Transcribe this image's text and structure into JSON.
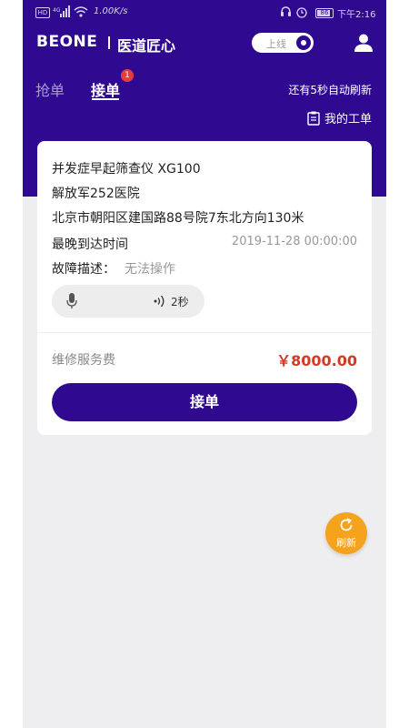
{
  "status_bar": {
    "hd": "HD",
    "network": "4G",
    "speed": "1.00K/s",
    "battery": "86",
    "time": "下午2:16"
  },
  "app_bar": {
    "logo": "BEONE",
    "brand": "医道匠心",
    "online_toggle": "上线"
  },
  "tabs": {
    "grab": "抢单",
    "accept": "接单",
    "accept_badge": "1"
  },
  "auto_refresh": "还有5秒自动刷新",
  "my_orders": "我的工单",
  "order": {
    "device": "并发症早起筛查仪 XG100",
    "hospital": "解放军252医院",
    "address": "北京市朝阳区建国路88号院7东北方向130米",
    "latest_label": "最晚到达时间",
    "latest_time": "2019-11-28 00:00:00",
    "fault_label": "故障描述：",
    "fault_value": "无法操作",
    "voice_duration": "2秒",
    "fee_label": "维修服务费",
    "fee_value": "￥8000.00",
    "accept_button": "接单"
  },
  "refresh_button": "刷新",
  "colors": {
    "primary": "#2f0a91",
    "price": "#d33a25",
    "badge": "#ea3b3b",
    "fab": "#f5a31d"
  }
}
